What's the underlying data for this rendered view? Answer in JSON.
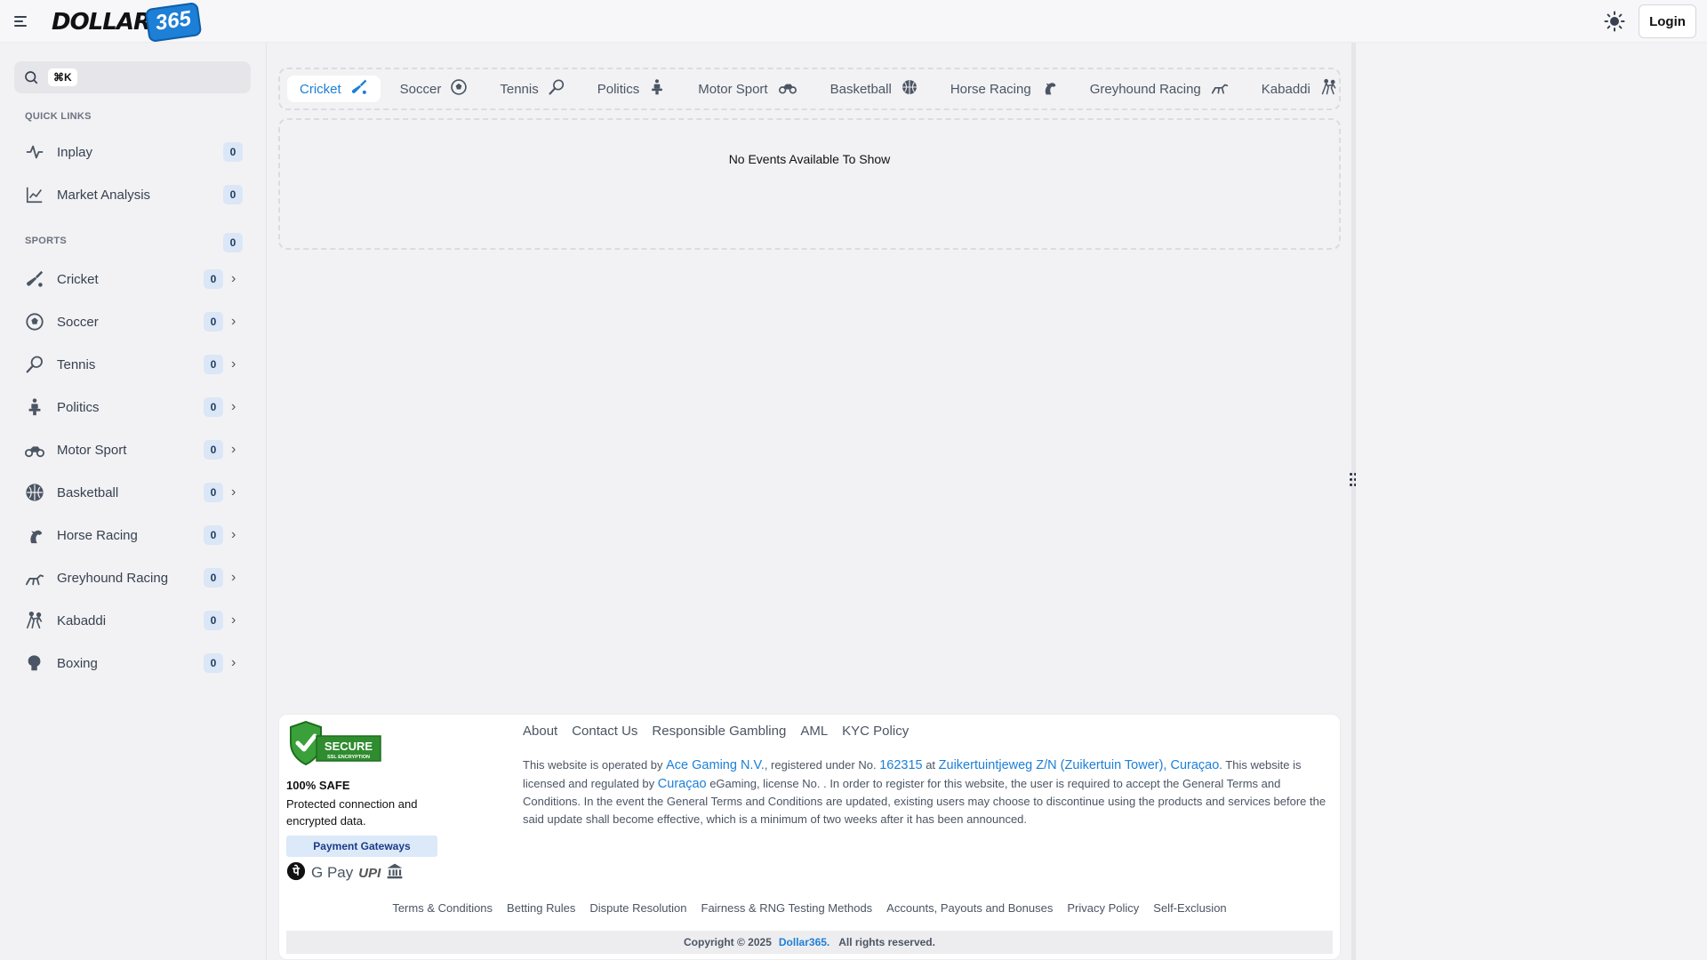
{
  "header": {
    "logo_text": "DOLLAR",
    "logo_badge": "365",
    "login_label": "Login"
  },
  "sidebar": {
    "search_shortcut": "⌘K",
    "quick_links_title": "QUICK LINKS",
    "quick_links": [
      {
        "label": "Inplay",
        "count": "0",
        "icon": "pulse-icon"
      },
      {
        "label": "Market Analysis",
        "count": "0",
        "icon": "chart-line-icon"
      }
    ],
    "sports_title": "SPORTS",
    "sports_count": "0",
    "sports": [
      {
        "label": "Cricket",
        "count": "0",
        "icon": "cricket-bat-icon"
      },
      {
        "label": "Soccer",
        "count": "0",
        "icon": "soccer-ball-icon"
      },
      {
        "label": "Tennis",
        "count": "0",
        "icon": "tennis-racket-icon"
      },
      {
        "label": "Politics",
        "count": "0",
        "icon": "politics-icon"
      },
      {
        "label": "Motor Sport",
        "count": "0",
        "icon": "motorcycle-icon"
      },
      {
        "label": "Basketball",
        "count": "0",
        "icon": "basketball-icon"
      },
      {
        "label": "Horse Racing",
        "count": "0",
        "icon": "horse-icon"
      },
      {
        "label": "Greyhound Racing",
        "count": "0",
        "icon": "greyhound-icon"
      },
      {
        "label": "Kabaddi",
        "count": "0",
        "icon": "kabaddi-icon"
      },
      {
        "label": "Boxing",
        "count": "0",
        "icon": "boxing-glove-icon"
      }
    ]
  },
  "main": {
    "tabs": [
      {
        "label": "Cricket",
        "icon": "cricket-bat-icon",
        "active": true
      },
      {
        "label": "Soccer",
        "icon": "soccer-ball-icon"
      },
      {
        "label": "Tennis",
        "icon": "tennis-racket-icon"
      },
      {
        "label": "Politics",
        "icon": "politics-icon"
      },
      {
        "label": "Motor Sport",
        "icon": "motorcycle-icon"
      },
      {
        "label": "Basketball",
        "icon": "basketball-icon"
      },
      {
        "label": "Horse Racing",
        "icon": "horse-icon"
      },
      {
        "label": "Greyhound Racing",
        "icon": "greyhound-icon"
      },
      {
        "label": "Kabaddi",
        "icon": "kabaddi-icon"
      }
    ],
    "empty_message": "No Events Available To Show"
  },
  "footer": {
    "secure_badge_text": "SECURE",
    "secure_badge_sub": "SSL ENCRYPTION",
    "safe_title": "100% SAFE",
    "safe_desc": "Protected connection and encrypted data.",
    "payment_gateways_label": "Payment Gateways",
    "gpay_label": "G Pay",
    "upi_label": "UPI",
    "links": [
      "About",
      "Contact Us",
      "Responsible Gambling",
      "AML",
      "KYC Policy"
    ],
    "legal": {
      "p1": "This website is operated by ",
      "company": "Ace Gaming N.V.",
      "p2": ", registered under No. ",
      "reg_no": "162315",
      "p3": " at ",
      "address": "Zuikertuintjeweg Z/N (Zuikertuin Tower), Curaçao",
      "p4": ". This website is licensed and regulated by ",
      "regulator": "Curaçao",
      "p5": " eGaming, license No. . In order to register for this website, the user is required to accept the General Terms and Conditions. In the event the General Terms and Conditions are updated, existing users may choose to discontinue using the products and services before the said update shall become effective, which is a minimum of two weeks after it has been announced."
    },
    "bottom_links": [
      "Terms & Conditions",
      "Betting Rules",
      "Dispute Resolution",
      "Fairness & RNG Testing Methods",
      "Accounts, Payouts and Bonuses",
      "Privacy Policy",
      "Self-Exclusion"
    ],
    "copyright": "Copyright © 2025",
    "copyright_brand": "Dollar365.",
    "copyright_suffix": "All rights reserved."
  },
  "colors": {
    "accent": "#1d7fd6",
    "count_badge_bg": "#dbe7f6",
    "page_bg": "#f2f2f4"
  }
}
